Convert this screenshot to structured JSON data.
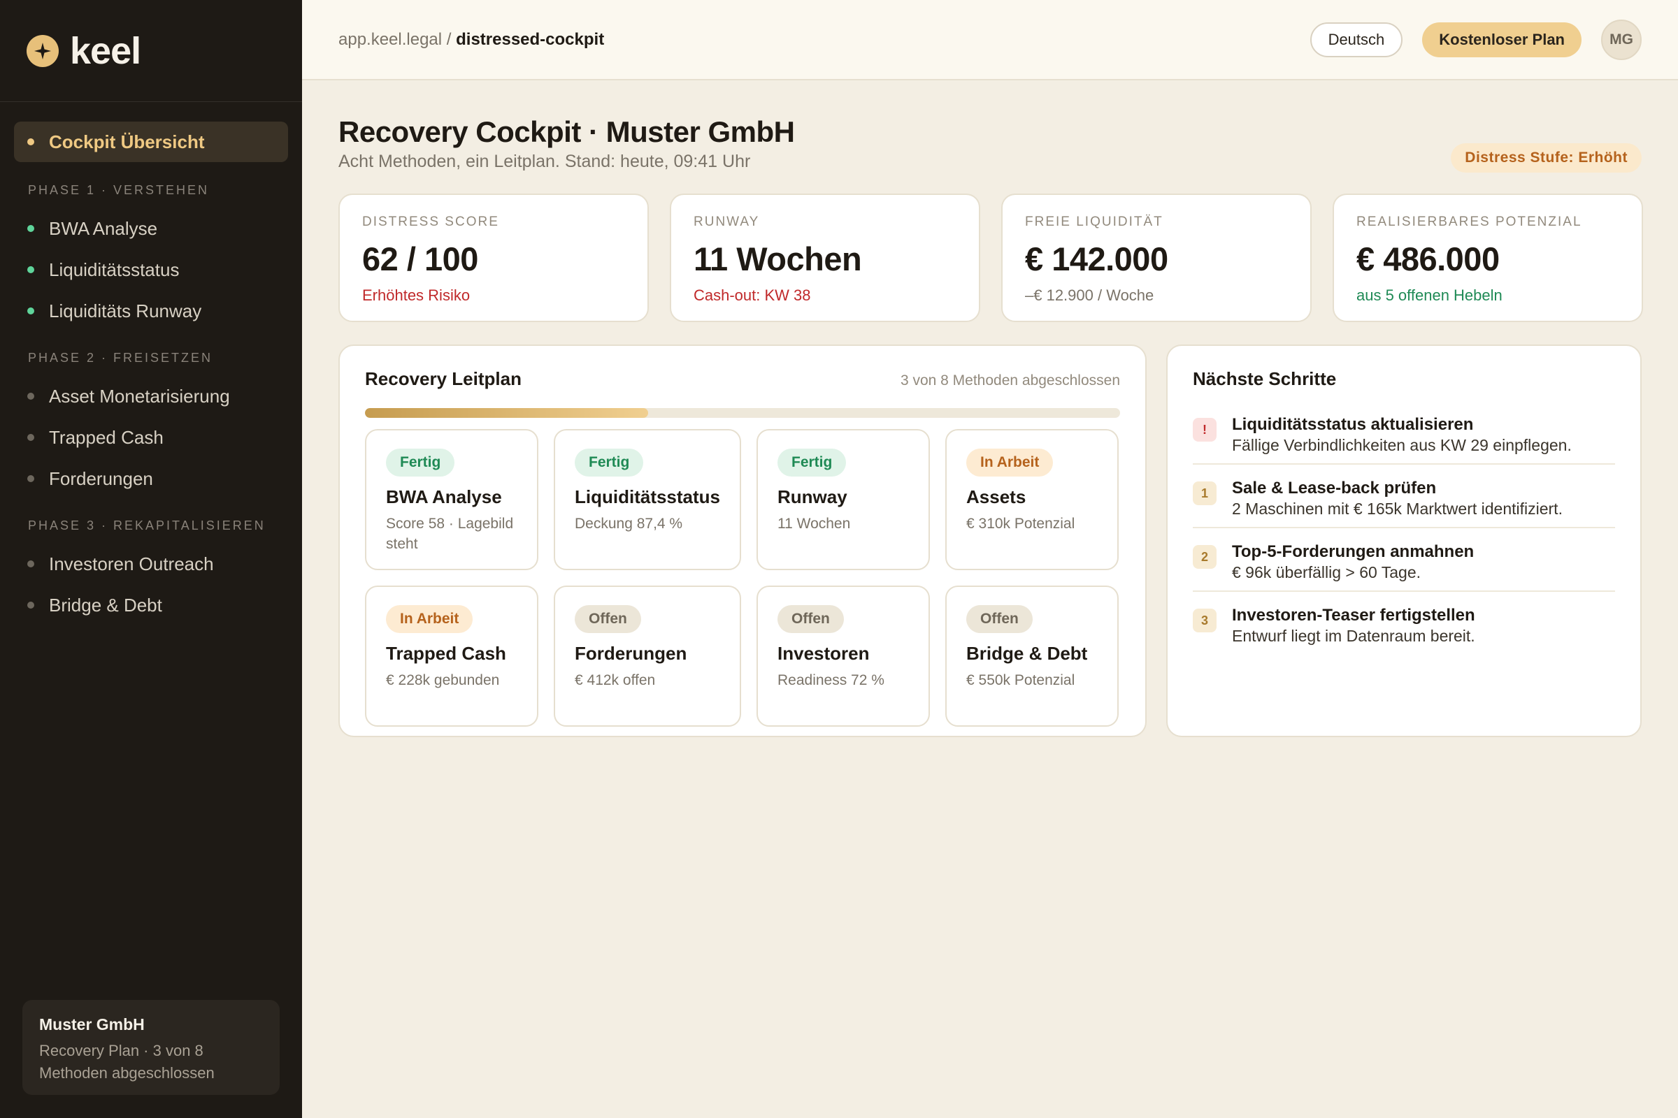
{
  "brand": {
    "name": "keel"
  },
  "sidebar": {
    "active": "Cockpit Übersicht",
    "sections": [
      {
        "title": "PHASE 1 · VERSTEHEN",
        "items": [
          "BWA Analyse",
          "Liquiditätsstatus",
          "Liquiditäts Runway"
        ]
      },
      {
        "title": "PHASE 2 · FREISETZEN",
        "items": [
          "Asset Monetarisierung",
          "Trapped Cash",
          "Forderungen"
        ]
      },
      {
        "title": "PHASE 3 · REKAPITALISIEREN",
        "items": [
          "Investoren Outreach",
          "Bridge & Debt"
        ]
      }
    ],
    "card": {
      "title": "Muster GmbH",
      "subtitle": "Recovery Plan · 3 von 8 Methoden abgeschlossen"
    }
  },
  "topbar": {
    "domain": "app.keel.legal /",
    "page": "distressed-cockpit",
    "language": "Deutsch",
    "plan": "Kostenloser Plan",
    "avatar": "MG"
  },
  "header": {
    "title": "Recovery Cockpit · Muster GmbH",
    "subtitle": "Acht Methoden, ein Leitplan. Stand: heute, 09:41 Uhr",
    "distress": "Distress Stufe: Erhöht"
  },
  "kpis": [
    {
      "label": "DISTRESS SCORE",
      "value": "62 / 100",
      "note": "Erhöhtes Risiko"
    },
    {
      "label": "RUNWAY",
      "value": "11 Wochen",
      "note": "Cash-out: KW 38"
    },
    {
      "label": "FREIE LIQUIDITÄT",
      "value": "€ 142.000",
      "note": "–€ 12.900 / Woche"
    },
    {
      "label": "REALISIERBARES POTENZIAL",
      "value": "€ 486.000",
      "note": "aus 5 offenen Hebeln"
    }
  ],
  "leitplan": {
    "title": "Recovery Leitplan",
    "meta": "3 von 8 Methoden abgeschlossen",
    "progress": 0.375,
    "methods": [
      {
        "status": "Fertig",
        "name": "BWA Analyse",
        "detail": "Score 58 · Lagebild steht"
      },
      {
        "status": "Fertig",
        "name": "Liquiditätsstatus",
        "detail": "Deckung 87,4 %"
      },
      {
        "status": "Fertig",
        "name": "Runway",
        "detail": "11 Wochen"
      },
      {
        "status": "In Arbeit",
        "name": "Assets",
        "detail": "€ 310k Potenzial"
      },
      {
        "status": "In Arbeit",
        "name": "Trapped Cash",
        "detail": "€ 228k gebunden"
      },
      {
        "status": "Offen",
        "name": "Forderungen",
        "detail": "€ 412k offen"
      },
      {
        "status": "Offen",
        "name": "Investoren",
        "detail": "Readiness 72 %"
      },
      {
        "status": "Offen",
        "name": "Bridge & Debt",
        "detail": "€ 550k Potenzial"
      }
    ]
  },
  "steps": {
    "title": "Nächste Schritte",
    "items": [
      {
        "badge": "!",
        "title": "Liquiditätsstatus aktualisieren",
        "desc": "Fällige Verbindlichkeiten aus KW 29 einpflegen."
      },
      {
        "badge": "1",
        "title": "Sale & Lease-back prüfen",
        "desc": "2 Maschinen mit € 165k Marktwert identifiziert."
      },
      {
        "badge": "2",
        "title": "Top-5-Forderungen anmahnen",
        "desc": "€ 96k überfällig > 60 Tage."
      },
      {
        "badge": "3",
        "title": "Investoren-Teaser fertigstellen",
        "desc": "Entwurf liegt im Datenraum bereit."
      }
    ]
  },
  "colors": {
    "sidebar_bg": "#1e1a15",
    "accent_gold": "#efc983",
    "done_green": "#1f8a55",
    "work_orange": "#b5621c",
    "risk_red": "#c0292a"
  }
}
